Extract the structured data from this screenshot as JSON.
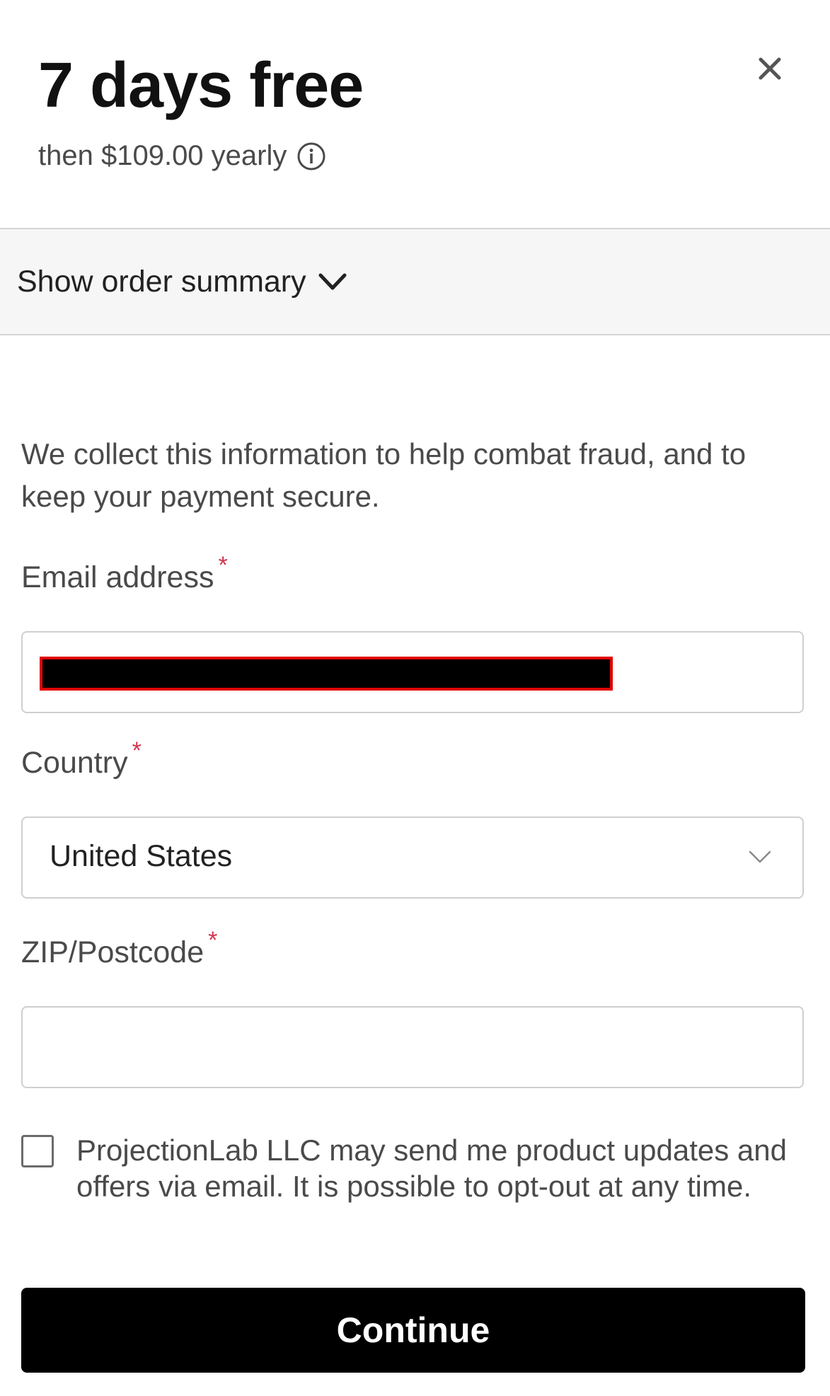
{
  "header": {
    "title": "7 days free",
    "price_text": "then $109.00 yearly",
    "info_icon": "info-circle-icon",
    "close_icon": "close-x-icon"
  },
  "summary": {
    "toggle_label": "Show order summary",
    "icon": "chevron-down-icon"
  },
  "form": {
    "intro": "We collect this information to help combat fraud, and to keep your payment secure.",
    "required_marker": "*",
    "email": {
      "label": "Email address",
      "value_redacted": true
    },
    "country": {
      "label": "Country",
      "selected": "United States",
      "icon": "chevron-down-icon"
    },
    "zip": {
      "label": "ZIP/Postcode",
      "value": ""
    },
    "consent": {
      "checked": false,
      "text": "ProjectionLab LLC may send me product updates and offers via email. It is possible to opt-out at any time."
    },
    "submit_label": "Continue"
  },
  "colors": {
    "required": "#d3344d",
    "button_bg": "#000000",
    "redaction_border": "#e00000"
  }
}
